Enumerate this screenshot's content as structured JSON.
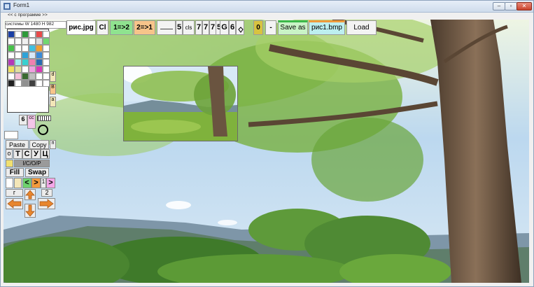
{
  "window": {
    "title": "Form1"
  },
  "colors": {
    "titlebar": "#d6e2f0",
    "green_button": "#8fe38f",
    "orange_button": "#f7c48a",
    "yellow_button": "#d8c340",
    "sky": "#bcd8ef",
    "foliage": "#6fa93a",
    "trunk": "#6a5440"
  },
  "nav": {
    "back_to_programs": "<< с программе >>",
    "canvas_info": "системы W 1480 H 982"
  },
  "toolbar": {
    "picture_file": "рис.jpg",
    "clear": "Cl",
    "copy_1_to_2": "1=>2",
    "copy_2_to_1": "2=>1",
    "size_value": "5",
    "cls": "cls",
    "n1": "7",
    "n2": "7",
    "n3": "7",
    "n4": "5",
    "g": "G",
    "six": "6",
    "zero": "0",
    "minus": "-",
    "save_as": "Save as",
    "bmp_file": "рис1.bmp",
    "load": "Load"
  },
  "side": {
    "letters": [
      "d",
      "В",
      "а"
    ],
    "num6": "6",
    "cc": "cc",
    "paste": "Paste",
    "copy": "Copy",
    "o": "o",
    "t": "T",
    "c": "С",
    "u": "У",
    "ts": "Ц",
    "mode": "I/C/O/P",
    "fill": "Fill",
    "swap": "Swap",
    "lt": "<",
    "gt": ">",
    "one": "1",
    "g_label": "г",
    "two": "2",
    "p": "п"
  }
}
